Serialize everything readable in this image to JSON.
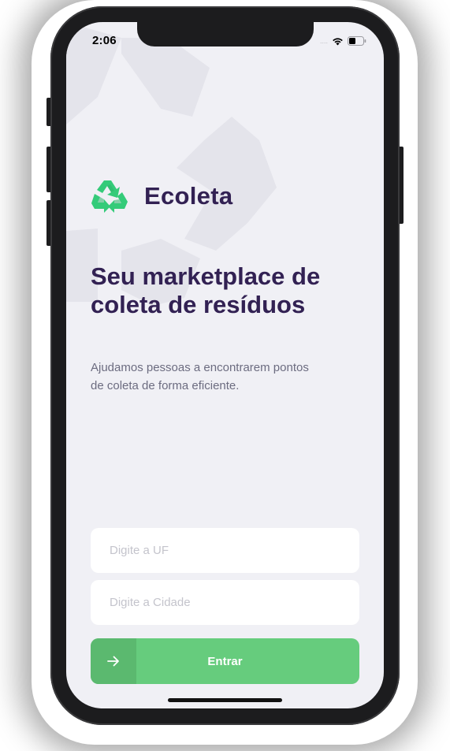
{
  "status_bar": {
    "time": "2:06",
    "signal": "....",
    "icons": [
      "wifi-icon",
      "battery-icon"
    ]
  },
  "brand": {
    "name": "Ecoleta",
    "logo_icon": "recycle-icon"
  },
  "hero": {
    "title": "Seu marketplace de coleta de resíduos",
    "description": "Ajudamos pessoas a encontrarem pontos de coleta de forma eficiente."
  },
  "form": {
    "uf_placeholder": "Digite a UF",
    "city_placeholder": "Digite a Cidade",
    "submit_label": "Entrar",
    "submit_icon": "arrow-right-icon"
  },
  "colors": {
    "primary": "#34CB79",
    "button": "#66CC7D",
    "button_icon_box": "#5BB96F",
    "title": "#322153",
    "text": "#6C6C80",
    "background": "#F0F0F5"
  }
}
